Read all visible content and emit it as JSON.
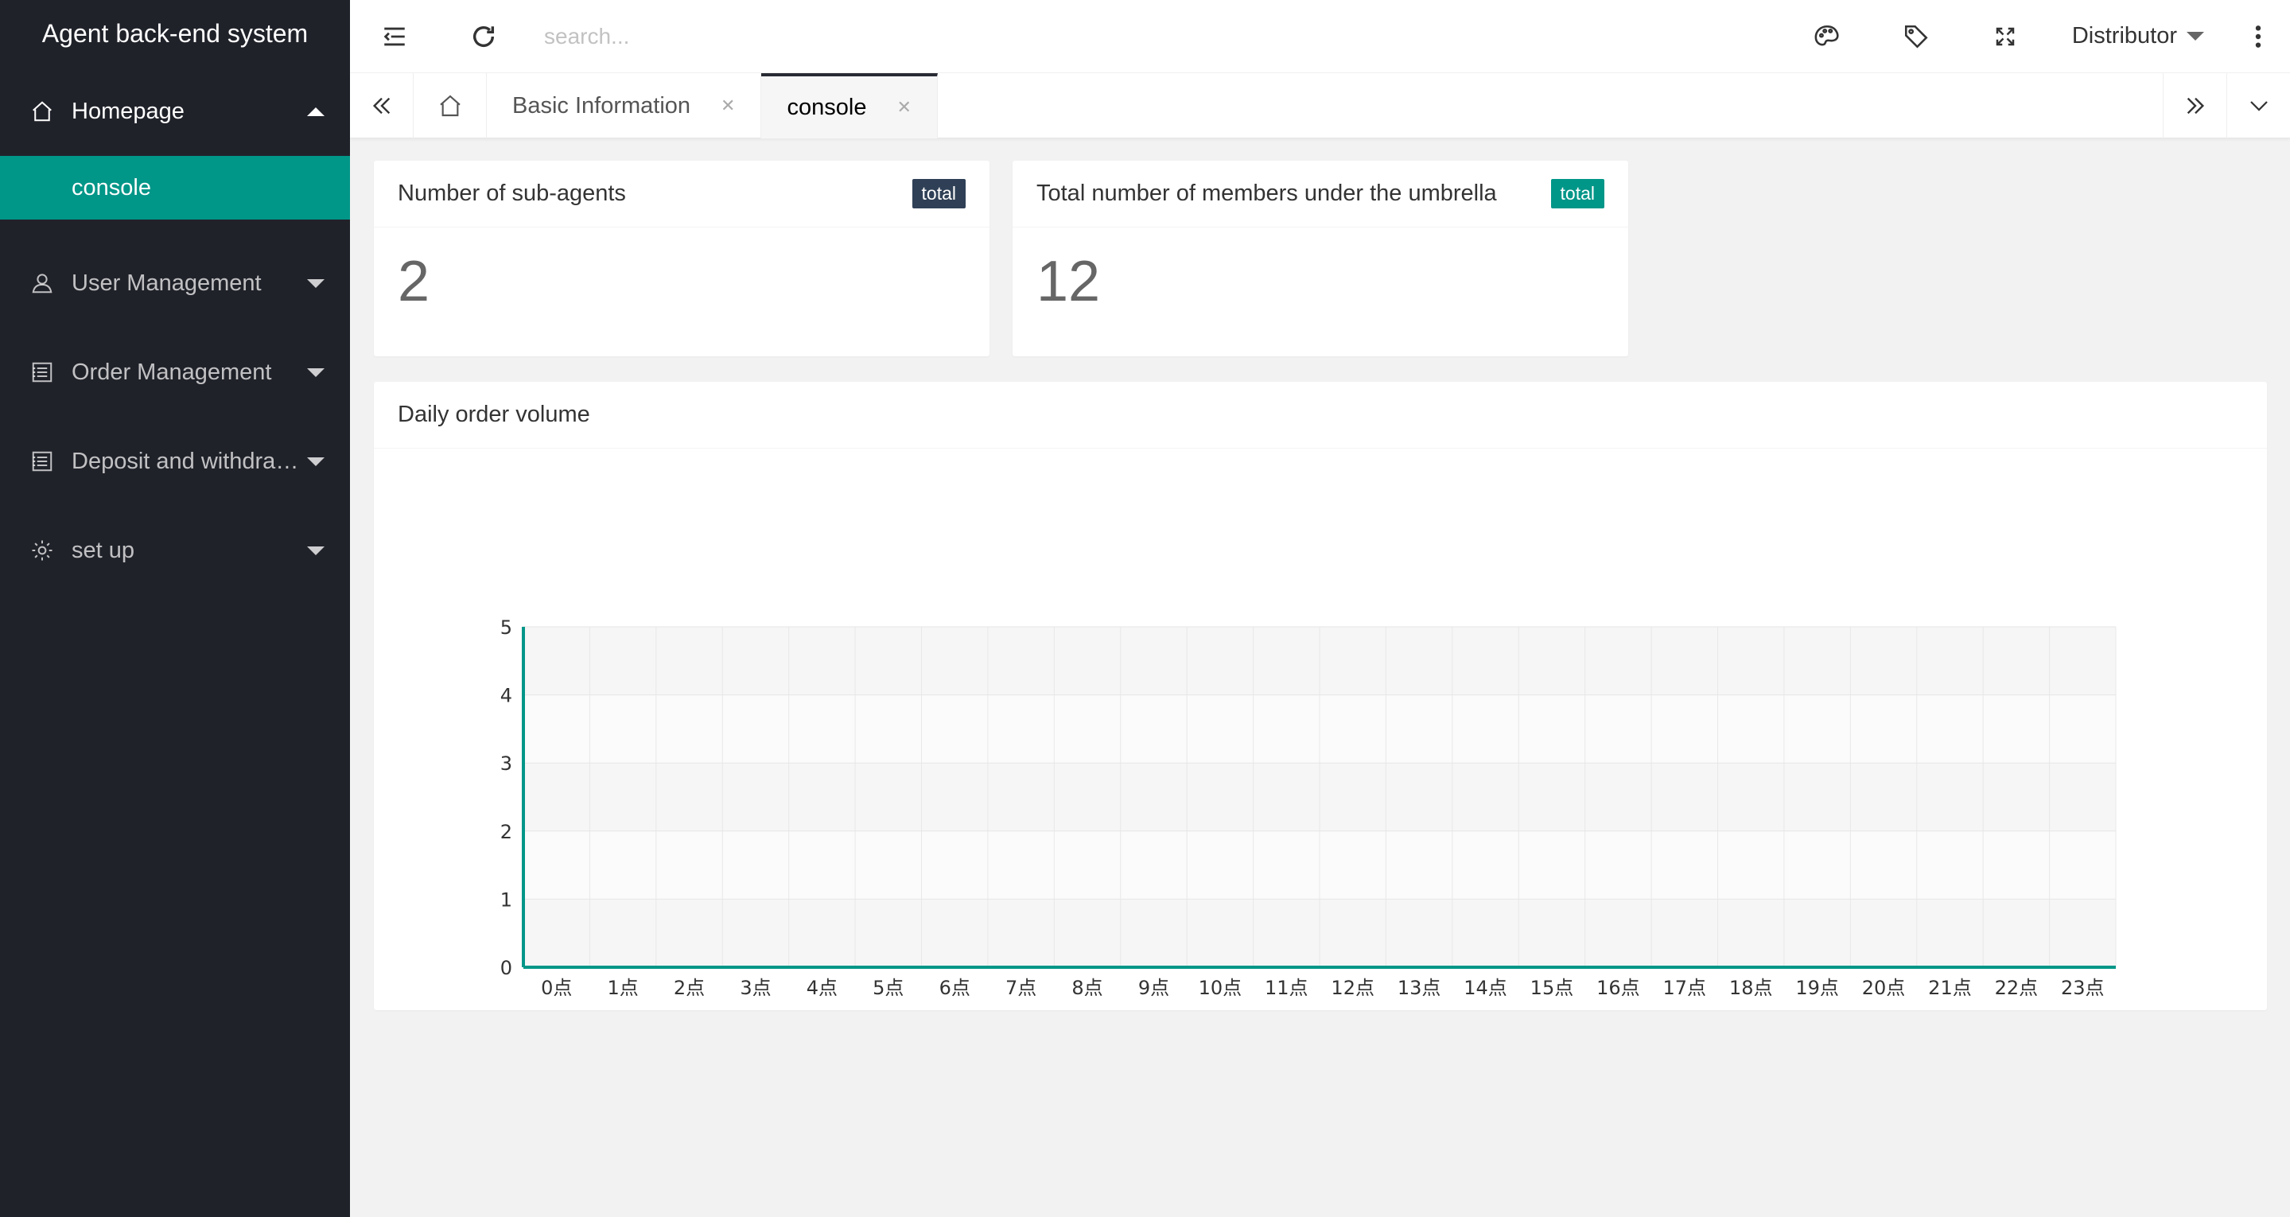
{
  "app": {
    "title": "Agent back-end system"
  },
  "sidebar": {
    "items": [
      {
        "label": "Homepage",
        "icon": "home-icon",
        "open": true,
        "children": [
          {
            "label": "console"
          }
        ]
      },
      {
        "label": "User Management",
        "icon": "user-icon"
      },
      {
        "label": "Order Management",
        "icon": "list-icon"
      },
      {
        "label": "Deposit and withdra…",
        "icon": "list-icon"
      },
      {
        "label": "set up",
        "icon": "gear-icon"
      }
    ]
  },
  "header": {
    "search_placeholder": "search...",
    "user": "Distributor"
  },
  "tabs": [
    {
      "label": "Basic Information",
      "active": false
    },
    {
      "label": "console",
      "active": true
    }
  ],
  "cards": {
    "subagents": {
      "title": "Number of sub-agents",
      "badge": "total",
      "value": "2"
    },
    "members": {
      "title": "Total number of members under the umbrella",
      "badge": "total",
      "value": "12"
    }
  },
  "colors": {
    "accent": "#009688",
    "sidebar": "#20222a",
    "badge_dark": "#2f4056"
  },
  "chart_data": {
    "type": "line",
    "title": "Daily order volume",
    "categories": [
      "0点",
      "1点",
      "2点",
      "3点",
      "4点",
      "5点",
      "6点",
      "7点",
      "8点",
      "9点",
      "10点",
      "11点",
      "12点",
      "13点",
      "14点",
      "15点",
      "16点",
      "17点",
      "18点",
      "19点",
      "20点",
      "21点",
      "22点",
      "23点"
    ],
    "series": [
      {
        "values": [
          0,
          0,
          0,
          0,
          0,
          0,
          0,
          0,
          0,
          0,
          0,
          0,
          0,
          0,
          0,
          0,
          0,
          0,
          0,
          0,
          0,
          0,
          0,
          0
        ]
      }
    ],
    "ylim": [
      0,
      5
    ],
    "yticks": [
      0,
      1,
      2,
      3,
      4,
      5
    ],
    "grid": true,
    "color": "#009688"
  }
}
